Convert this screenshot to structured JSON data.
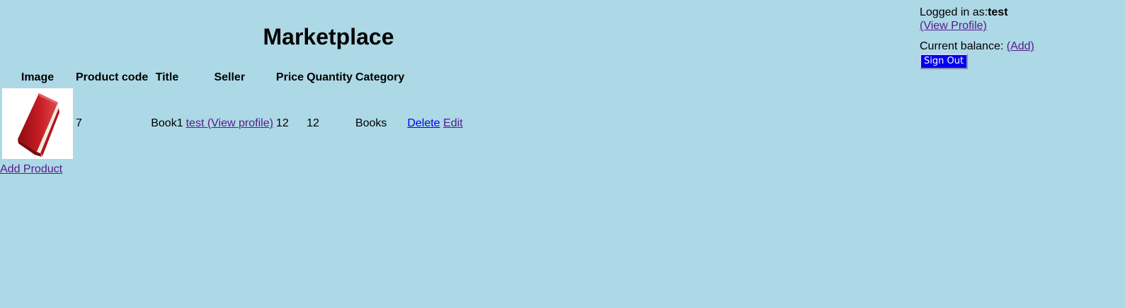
{
  "header": {
    "title": "Marketplace"
  },
  "user": {
    "logged_in_label": "Logged in as:",
    "username": "test",
    "view_profile_link": "(View Profile)",
    "balance_label": "Current balance:",
    "add_balance_link": "(Add)",
    "signout_label": "Sign Out"
  },
  "table": {
    "columns": [
      "Image",
      "Product code",
      "Title",
      "Seller",
      "Price",
      "Quantity",
      "Category"
    ],
    "rows": [
      {
        "image_icon": "red-book-icon",
        "product_code": "7",
        "title": "Book1",
        "seller_link": "test (View profile)",
        "price": "12",
        "quantity": "12",
        "category": "Books",
        "delete_label": "Delete",
        "edit_label": "Edit"
      }
    ]
  },
  "actions": {
    "add_product_label": "Add Product"
  },
  "colors": {
    "background": "#add8e6",
    "link_visited": "#551a8b",
    "link": "#0000ee",
    "signout_button": "#0000ee"
  }
}
